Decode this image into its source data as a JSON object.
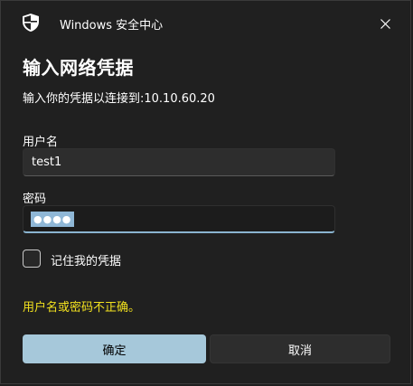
{
  "window": {
    "title": "Windows 安全中心",
    "icon": "shield-icon",
    "close_icon": "close-icon"
  },
  "dialog": {
    "heading": "输入网络凭据",
    "subtitle": "输入你的凭据以连接到:10.10.60.20"
  },
  "username": {
    "label": "用户名",
    "value": "test1"
  },
  "password": {
    "label": "密码",
    "masked_value": "●●●●"
  },
  "remember": {
    "label": "记住我的凭据",
    "checked": false
  },
  "error_message": "用户名或密码不正确。",
  "buttons": {
    "ok_label": "确定",
    "cancel_label": "取消"
  },
  "colors": {
    "background": "#202020",
    "accent": "#a6c8da",
    "error": "#f3e21f",
    "input_bg": "#2d2d2d"
  }
}
